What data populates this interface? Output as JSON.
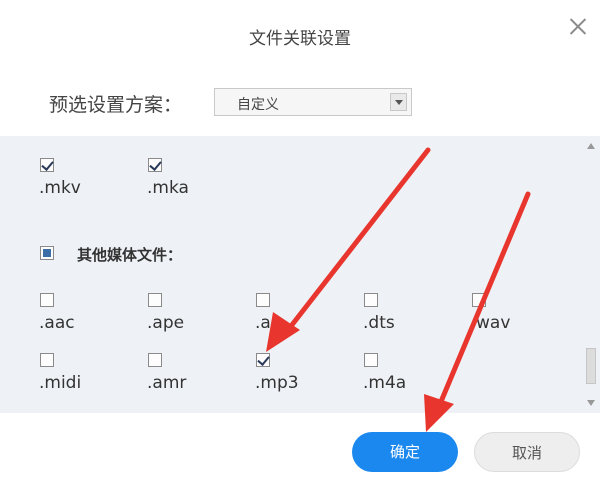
{
  "dialog": {
    "title": "文件关联设置",
    "close_icon": "close-icon"
  },
  "preset": {
    "label": "预选设置方案：",
    "value": "自定义"
  },
  "video_items": [
    {
      "label": ".mkv",
      "checked": true
    },
    {
      "label": ".mka",
      "checked": true
    }
  ],
  "other_media": {
    "label": "其他媒体文件：",
    "state": "partial"
  },
  "media_items": [
    {
      "label": ".aac",
      "checked": false
    },
    {
      "label": ".ape",
      "checked": false
    },
    {
      "label": ".ac",
      "checked": false
    },
    {
      "label": ".dts",
      "checked": false
    },
    {
      "label": "wav",
      "checked": false
    },
    {
      "label": ".midi",
      "checked": false
    },
    {
      "label": ".amr",
      "checked": false
    },
    {
      "label": ".mp3",
      "checked": true
    },
    {
      "label": ".m4a",
      "checked": false
    }
  ],
  "buttons": {
    "ok": "确定",
    "cancel": "取消"
  },
  "colors": {
    "accent": "#1a88ee",
    "annotation_arrow": "#e8362e"
  }
}
